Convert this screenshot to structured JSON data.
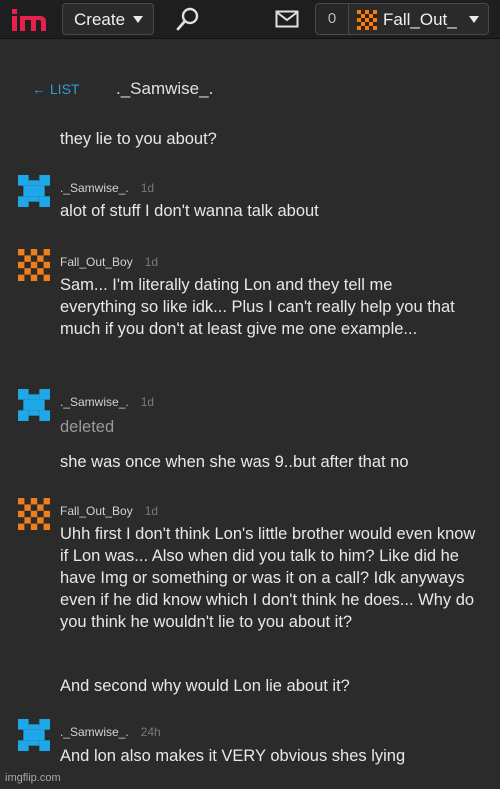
{
  "header": {
    "logo_text": "im",
    "create_label": "Create",
    "notification_count": "0",
    "username": "Fall_Out_"
  },
  "thread": {
    "back_label": "← LIST",
    "title": "._Samwise_."
  },
  "messages": [
    {
      "text": "they lie to you about?"
    },
    {
      "user": "._Samwise_.",
      "time": "1d",
      "avatar": "blue-pixel-avatar",
      "lines": [
        "alot of stuff I don't wanna talk about"
      ]
    },
    {
      "user": "Fall_Out_Boy",
      "time": "1d",
      "avatar": "orange-checker-avatar",
      "lines": [
        "Sam... I'm literally dating Lon and they tell me everything so like idk... Plus I can't really help you that much if you don't at least give me one example..."
      ]
    },
    {
      "user": "._Samwise_.",
      "time": "1d",
      "avatar": "blue-pixel-avatar",
      "lines": [
        "deleted",
        "she was once when she was 9..but after that no"
      ]
    },
    {
      "user": "Fall_Out_Boy",
      "time": "1d",
      "avatar": "orange-checker-avatar",
      "lines": [
        "Uhh first I don't think Lon's little brother would even know if Lon was... Also when did you talk to him? Like did he have Img or something or was it on a call? Idk anyways even if he did know which I don't think he does... Why do you think he wouldn't lie to you about it?",
        "And second why would Lon lie about it?"
      ]
    },
    {
      "user": "._Samwise_.",
      "time": "24h",
      "avatar": "blue-pixel-avatar",
      "lines": [
        "And lon also makes it VERY obvious shes lying"
      ]
    }
  ],
  "watermark": "imgflip.com",
  "colors": {
    "accent_blue": "#2f9bd8",
    "avatar_blue": "#1fa8e8",
    "avatar_orange": "#f07e1a",
    "logo_red": "#e8204e"
  }
}
